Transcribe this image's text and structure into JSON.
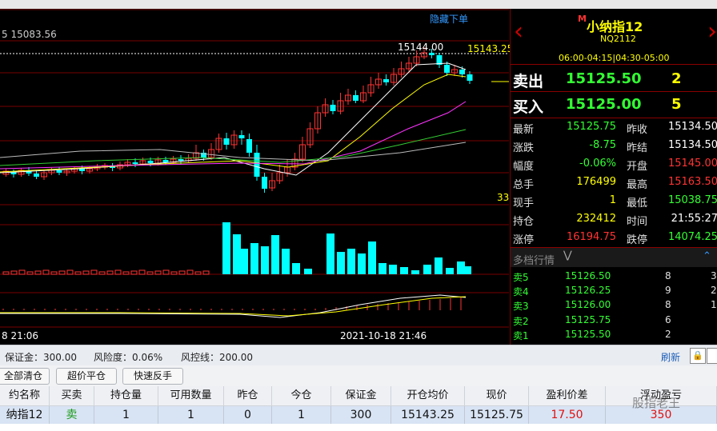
{
  "chart": {
    "top_left_value": "5 15083.56",
    "hide_orders_label": "隐藏下单",
    "peak_label": "15144.00",
    "dashed_line_label": "15143.25",
    "right_axis_value": "33",
    "time_left": "8 21:06",
    "time_right": "2021-10-18 21:46",
    "colors": {
      "up": "#ff3333",
      "down": "#00ffff",
      "ma1": "#ffffff",
      "ma2": "#ffff00",
      "ma3": "#ff33ff",
      "ma4": "#33cc33",
      "ma5": "#bbbbbb"
    }
  },
  "contract": {
    "marker": "M",
    "name": "小纳指12",
    "code": "NQ2112",
    "sessions": "06:00-04:15|04:30-05:00"
  },
  "ask": {
    "label": "卖出",
    "price": "15125.50",
    "volume": "2"
  },
  "bid": {
    "label": "买入",
    "price": "15125.00",
    "volume": "5"
  },
  "stats": [
    {
      "l1": "最新",
      "v1": "15125.75",
      "c1": "#33ff33",
      "l2": "昨收",
      "v2": "15134.50",
      "c2": "#ffffff"
    },
    {
      "l1": "涨跌",
      "v1": "-8.75",
      "c1": "#33ff33",
      "l2": "昨结",
      "v2": "15134.50",
      "c2": "#ffffff"
    },
    {
      "l1": "幅度",
      "v1": "-0.06%",
      "c1": "#33ff33",
      "l2": "开盘",
      "v2": "15145.00",
      "c2": "#ff3333"
    },
    {
      "l1": "总手",
      "v1": "176499",
      "c1": "#ffff00",
      "l2": "最高",
      "v2": "15163.50",
      "c2": "#ff3333"
    },
    {
      "l1": "现手",
      "v1": "1",
      "c1": "#ffff00",
      "l2": "最低",
      "v2": "15038.75",
      "c2": "#33ff33"
    },
    {
      "l1": "持仓",
      "v1": "232412",
      "c1": "#ffff00",
      "l2": "时间",
      "v2": "21:55:27",
      "c2": "#ffffff"
    },
    {
      "l1": "涨停",
      "v1": "16194.75",
      "c1": "#ff3333",
      "l2": "跌停",
      "v2": "14074.25",
      "c2": "#33ff33"
    }
  ],
  "depth": {
    "title": "多档行情",
    "rows": [
      {
        "label": "卖5",
        "price": "15126.50",
        "vol": "8",
        "extra": "3"
      },
      {
        "label": "卖4",
        "price": "15126.25",
        "vol": "9",
        "extra": "2"
      },
      {
        "label": "卖3",
        "price": "15126.00",
        "vol": "8",
        "extra": "1"
      },
      {
        "label": "卖2",
        "price": "15125.75",
        "vol": "6",
        "extra": ""
      },
      {
        "label": "卖1",
        "price": "15125.50",
        "vol": "2",
        "extra": ""
      }
    ]
  },
  "account": {
    "margin": "保证金：300.00",
    "risk": "风险度：0.06%",
    "control": "风控线：200.00",
    "refresh": "刷新"
  },
  "buttons": {
    "close_all": "全部清仓",
    "super_close": "超价平仓",
    "quick_reverse": "快速反手"
  },
  "positions": {
    "headers": [
      "约名称",
      "买卖",
      "持仓量",
      "可用数量",
      "昨仓",
      "今仓",
      "保证金",
      "开仓均价",
      "现价",
      "盈利价差",
      "浮动盈亏"
    ],
    "row": [
      "纳指12",
      "卖",
      "1",
      "1",
      "0",
      "1",
      "300",
      "15143.25",
      "15125.75",
      "17.50",
      "350"
    ]
  },
  "watermark": "股指老王"
}
